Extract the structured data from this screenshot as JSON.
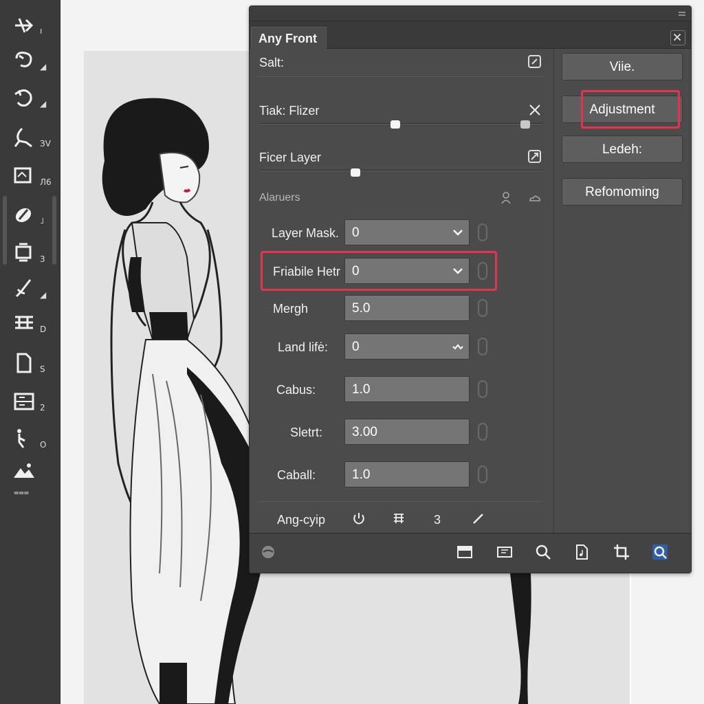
{
  "toolbar": {
    "tools": [
      {
        "name": "move-tool",
        "sub": "ı"
      },
      {
        "name": "lasso-tool",
        "sub": "◢"
      },
      {
        "name": "rotate-tool",
        "sub": "◢"
      },
      {
        "name": "pen-tool",
        "sub": "ЗV"
      },
      {
        "name": "frame-tool",
        "sub": "Л6"
      },
      {
        "name": "eraser-tool",
        "sub": "˩"
      },
      {
        "name": "stamp-tool",
        "sub": "3"
      },
      {
        "name": "brush-tool",
        "sub": "◢"
      },
      {
        "name": "text-tool",
        "sub": "D"
      },
      {
        "name": "document-tool",
        "sub": "S"
      },
      {
        "name": "layers-tool",
        "sub": "2"
      },
      {
        "name": "person-tool",
        "sub": "O"
      },
      {
        "name": "landscape-tool",
        "sub": "⩶"
      }
    ]
  },
  "panel": {
    "tab_title": "Any Front",
    "rows": {
      "salt": "Salt:",
      "tiak_filter": "Tiak: Flizer",
      "filter_layer": "Ficer Layer",
      "section_header": "Alaruers",
      "layer_mask_label": "Layer Mask.",
      "layer_mask_value": "0",
      "friabile_label": "Friabile Hetr",
      "friabile_value": "0",
      "mergh_label": "Mergh",
      "mergh_value": "5.0",
      "land_label": "Land lifė:",
      "land_value": "0",
      "cabus_label": "Cabus:",
      "cabus_value": "1.0",
      "sletrt_label": "Sletrt:",
      "sletrt_value": "3.00",
      "caball_label": "Caball:",
      "caball_value": "1.0"
    },
    "footer_row": {
      "label": "Ang-cyip",
      "count": "3"
    },
    "side_buttons": {
      "vie": "Viie.",
      "adjustment": "Adjustment",
      "ledeh": "Ledeh:",
      "reformatting": "Refomoming"
    },
    "sliders": {
      "tiak_filter_fraction": 0.48,
      "tiak_filter_end_fraction": 0.94,
      "filter_layer_fraction": 0.34
    }
  },
  "colors": {
    "highlight": "#e5334e",
    "panel_bg": "#4b4b4b",
    "toolbar_bg": "#3a3a3a"
  }
}
